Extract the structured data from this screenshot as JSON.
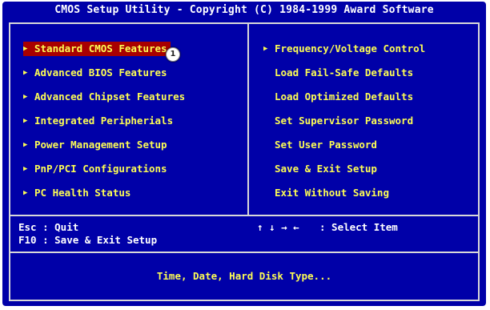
{
  "title": "CMOS Setup Utility - Copyright (C) 1984-1999 Award Software",
  "left_menu": [
    {
      "label": "Standard CMOS Features",
      "selected": true
    },
    {
      "label": "Advanced BIOS Features"
    },
    {
      "label": "Advanced Chipset Features"
    },
    {
      "label": "Integrated Peripherials"
    },
    {
      "label": "Power Management Setup"
    },
    {
      "label": "PnP/PCI Configurations"
    },
    {
      "label": "PC Health Status"
    }
  ],
  "right_menu": [
    {
      "label": "Frequency/Voltage Control",
      "has_arrow": true
    },
    {
      "label": "Load Fail-Safe Defaults"
    },
    {
      "label": "Load Optimized Defaults"
    },
    {
      "label": "Set Supervisor Password"
    },
    {
      "label": "Set User Password"
    },
    {
      "label": "Save & Exit Setup"
    },
    {
      "label": "Exit Without Saving"
    }
  ],
  "badge": "1",
  "help": {
    "esc_line": "Esc : Quit",
    "f10_line": "F10 : Save & Exit Setup",
    "arrows": "↑ ↓ → ←",
    "select_item": ": Select Item"
  },
  "status_text": "Time, Date, Hard Disk Type...",
  "colors": {
    "background": "#0000a8",
    "menu_text": "#fcfc54",
    "selected_bg": "#a80000",
    "help_text": "#ffffff",
    "border": "#d8d8d8"
  }
}
